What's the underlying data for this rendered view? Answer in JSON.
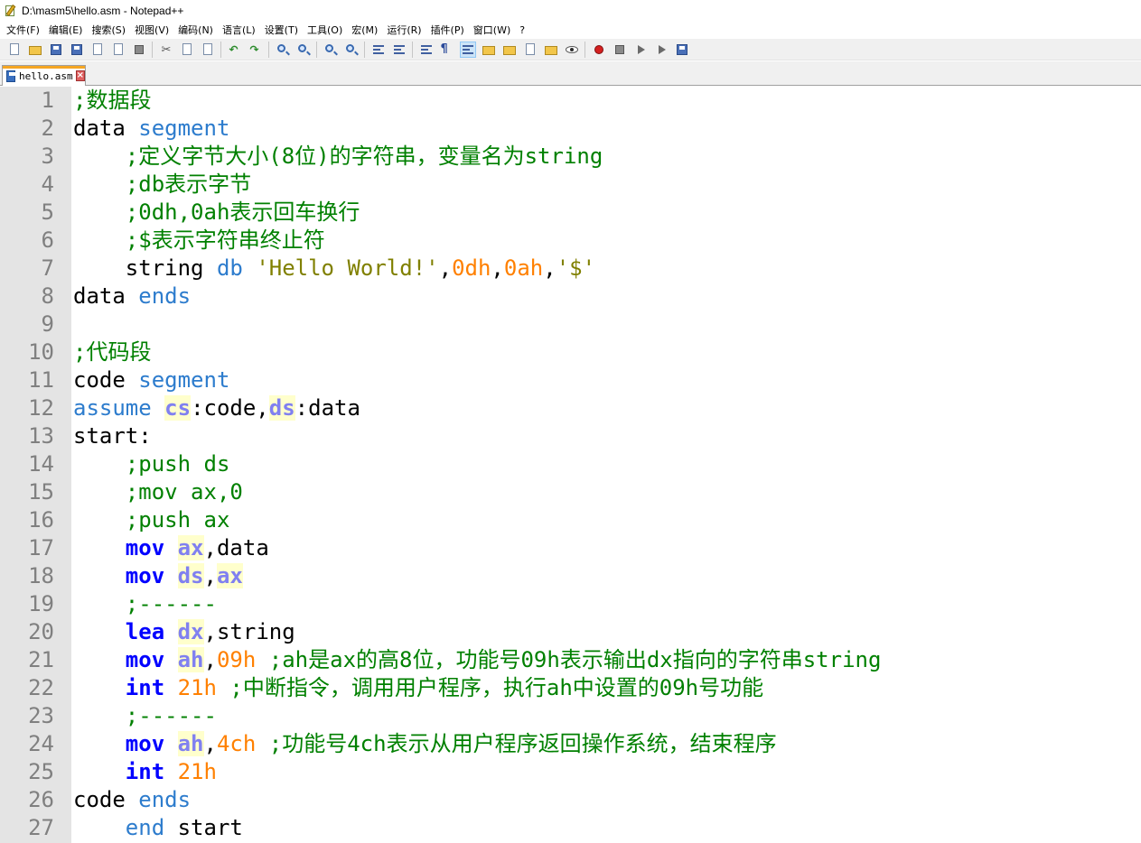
{
  "window": {
    "title": "D:\\masm5\\hello.asm - Notepad++"
  },
  "menu": {
    "items": [
      "文件(F)",
      "编辑(E)",
      "搜索(S)",
      "视图(V)",
      "编码(N)",
      "语言(L)",
      "设置(T)",
      "工具(O)",
      "宏(M)",
      "运行(R)",
      "插件(P)",
      "窗口(W)",
      "?"
    ]
  },
  "toolbar": {
    "icons": [
      "new-file-icon",
      "open-folder-icon",
      "save-icon",
      "save-all-icon",
      "close-icon",
      "close-all-icon",
      "print-icon",
      "cut-icon",
      "copy-icon",
      "paste-icon",
      "undo-icon",
      "redo-icon",
      "find-icon",
      "replace-icon",
      "zoom-in-icon",
      "zoom-out-icon",
      "sync-vertical-icon",
      "sync-horizontal-icon",
      "word-wrap-icon",
      "show-all-chars-icon",
      "indent-guide-icon",
      "document-map-icon",
      "function-list-icon",
      "folder-workspace-icon",
      "monitoring-icon",
      "eye-icon",
      "record-macro-icon",
      "stop-macro-icon",
      "play-macro-icon",
      "run-macro-multiple-icon",
      "save-macro-icon"
    ]
  },
  "tabs": [
    {
      "label": "hello.asm",
      "active": true
    }
  ],
  "editor": {
    "lines": [
      {
        "n": "1",
        "t": [
          {
            "c": "cmt",
            "v": ";数据段"
          }
        ]
      },
      {
        "n": "2",
        "t": [
          {
            "c": "",
            "v": "data "
          },
          {
            "c": "kw",
            "v": "segment"
          }
        ]
      },
      {
        "n": "3",
        "t": [
          {
            "c": "",
            "v": "    "
          },
          {
            "c": "cmt",
            "v": ";定义字节大小(8位)的字符串，变量名为string"
          }
        ]
      },
      {
        "n": "4",
        "t": [
          {
            "c": "",
            "v": "    "
          },
          {
            "c": "cmt",
            "v": ";db表示字节"
          }
        ]
      },
      {
        "n": "5",
        "t": [
          {
            "c": "",
            "v": "    "
          },
          {
            "c": "cmt",
            "v": ";0dh,0ah表示回车换行"
          }
        ]
      },
      {
        "n": "6",
        "t": [
          {
            "c": "",
            "v": "    "
          },
          {
            "c": "cmt",
            "v": ";$表示字符串终止符"
          }
        ]
      },
      {
        "n": "7",
        "t": [
          {
            "c": "",
            "v": "    string "
          },
          {
            "c": "kw",
            "v": "db"
          },
          {
            "c": "",
            "v": " "
          },
          {
            "c": "str",
            "v": "'Hello World!'"
          },
          {
            "c": "",
            "v": ","
          },
          {
            "c": "num",
            "v": "0dh"
          },
          {
            "c": "",
            "v": ","
          },
          {
            "c": "num",
            "v": "0ah"
          },
          {
            "c": "",
            "v": ","
          },
          {
            "c": "str",
            "v": "'$'"
          }
        ]
      },
      {
        "n": "8",
        "t": [
          {
            "c": "",
            "v": "data "
          },
          {
            "c": "kw",
            "v": "ends"
          }
        ]
      },
      {
        "n": "9",
        "t": []
      },
      {
        "n": "10",
        "t": [
          {
            "c": "cmt",
            "v": ";代码段"
          }
        ]
      },
      {
        "n": "11",
        "t": [
          {
            "c": "",
            "v": "code "
          },
          {
            "c": "kw",
            "v": "segment"
          }
        ]
      },
      {
        "n": "12",
        "t": [
          {
            "c": "kw",
            "v": "assume"
          },
          {
            "c": "",
            "v": " "
          },
          {
            "c": "reg",
            "v": "cs"
          },
          {
            "c": "",
            "v": ":code,"
          },
          {
            "c": "reg",
            "v": "ds"
          },
          {
            "c": "",
            "v": ":data"
          }
        ]
      },
      {
        "n": "13",
        "t": [
          {
            "c": "",
            "v": "start:"
          }
        ]
      },
      {
        "n": "14",
        "t": [
          {
            "c": "",
            "v": "    "
          },
          {
            "c": "cmt",
            "v": ";push ds"
          }
        ]
      },
      {
        "n": "15",
        "t": [
          {
            "c": "",
            "v": "    "
          },
          {
            "c": "cmt",
            "v": ";mov ax,0"
          }
        ]
      },
      {
        "n": "16",
        "t": [
          {
            "c": "",
            "v": "    "
          },
          {
            "c": "cmt",
            "v": ";push ax"
          }
        ]
      },
      {
        "n": "17",
        "t": [
          {
            "c": "",
            "v": "    "
          },
          {
            "c": "ins",
            "v": "mov"
          },
          {
            "c": "",
            "v": " "
          },
          {
            "c": "reg",
            "v": "ax"
          },
          {
            "c": "",
            "v": ",data"
          }
        ]
      },
      {
        "n": "18",
        "t": [
          {
            "c": "",
            "v": "    "
          },
          {
            "c": "ins",
            "v": "mov"
          },
          {
            "c": "",
            "v": " "
          },
          {
            "c": "reg",
            "v": "ds"
          },
          {
            "c": "",
            "v": ","
          },
          {
            "c": "reg",
            "v": "ax"
          }
        ]
      },
      {
        "n": "19",
        "t": [
          {
            "c": "",
            "v": "    "
          },
          {
            "c": "cmt",
            "v": ";------"
          }
        ]
      },
      {
        "n": "20",
        "t": [
          {
            "c": "",
            "v": "    "
          },
          {
            "c": "ins",
            "v": "lea"
          },
          {
            "c": "",
            "v": " "
          },
          {
            "c": "reg",
            "v": "dx"
          },
          {
            "c": "",
            "v": ",string"
          }
        ]
      },
      {
        "n": "21",
        "t": [
          {
            "c": "",
            "v": "    "
          },
          {
            "c": "ins",
            "v": "mov"
          },
          {
            "c": "",
            "v": " "
          },
          {
            "c": "reg",
            "v": "ah"
          },
          {
            "c": "",
            "v": ","
          },
          {
            "c": "num",
            "v": "09h"
          },
          {
            "c": "",
            "v": " "
          },
          {
            "c": "cmt",
            "v": ";ah是ax的高8位，功能号09h表示输出dx指向的字符串string"
          }
        ]
      },
      {
        "n": "22",
        "t": [
          {
            "c": "",
            "v": "    "
          },
          {
            "c": "ins",
            "v": "int"
          },
          {
            "c": "",
            "v": " "
          },
          {
            "c": "num",
            "v": "21h"
          },
          {
            "c": "",
            "v": " "
          },
          {
            "c": "cmt",
            "v": ";中断指令，调用用户程序，执行ah中设置的09h号功能"
          }
        ]
      },
      {
        "n": "23",
        "t": [
          {
            "c": "",
            "v": "    "
          },
          {
            "c": "cmt",
            "v": ";------"
          }
        ]
      },
      {
        "n": "24",
        "t": [
          {
            "c": "",
            "v": "    "
          },
          {
            "c": "ins",
            "v": "mov"
          },
          {
            "c": "",
            "v": " "
          },
          {
            "c": "reg",
            "v": "ah"
          },
          {
            "c": "",
            "v": ","
          },
          {
            "c": "num",
            "v": "4ch"
          },
          {
            "c": "",
            "v": " "
          },
          {
            "c": "cmt",
            "v": ";功能号4ch表示从用户程序返回操作系统，结束程序"
          }
        ]
      },
      {
        "n": "25",
        "t": [
          {
            "c": "",
            "v": "    "
          },
          {
            "c": "ins",
            "v": "int"
          },
          {
            "c": "",
            "v": " "
          },
          {
            "c": "num",
            "v": "21h"
          }
        ]
      },
      {
        "n": "26",
        "t": [
          {
            "c": "",
            "v": "code "
          },
          {
            "c": "kw",
            "v": "ends"
          }
        ]
      },
      {
        "n": "27",
        "t": [
          {
            "c": "",
            "v": "    "
          },
          {
            "c": "kw",
            "v": "end"
          },
          {
            "c": "",
            "v": " start"
          }
        ]
      }
    ]
  }
}
